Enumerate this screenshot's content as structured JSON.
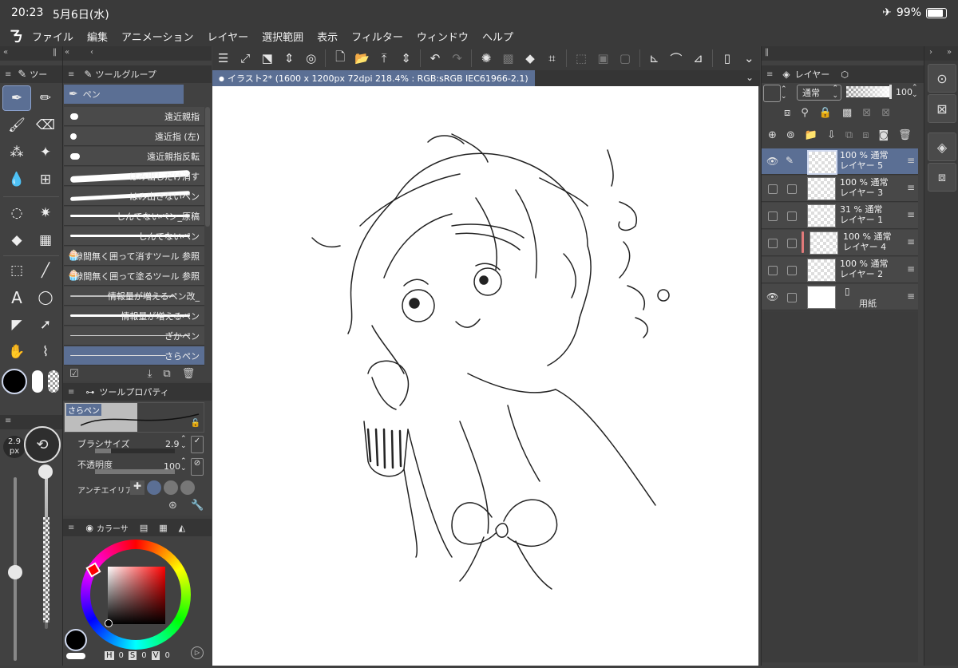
{
  "status": {
    "time": "20:23",
    "date": "5月6日(水)",
    "battery": "99%"
  },
  "menu": [
    "ファイル",
    "編集",
    "アニメーション",
    "レイヤー",
    "選択範囲",
    "表示",
    "フィルター",
    "ウィンドウ",
    "ヘルプ"
  ],
  "panels": {
    "tool_tab": "ツー",
    "subtool_tab": "ツールグループ",
    "subtool_group": "ペン",
    "toolprop_tab": "ツールプロパティ",
    "color_tab": "カラーサ",
    "layer_tab": "レイヤー"
  },
  "brushes": [
    "遠近親指",
    "遠近指 (左)",
    "遠近親指反転",
    "はみ出しだけ消す",
    "はみ出さないペン",
    "しんでないペン_原稿",
    "しんでないペン",
    "隙間無く囲って消すツール 参照",
    "隙間無く囲って塗るツール 参照",
    "情報量が増えるペン改_",
    "情報量が増えるペン",
    "ざかペン",
    "さらペン"
  ],
  "toolprop": {
    "preview_label": "さらペン",
    "brush_size_label": "ブラシサイズ",
    "brush_size_value": "2.9",
    "opacity_label": "不透明度",
    "opacity_value": "100",
    "antialias_label": "アンチエイリアス"
  },
  "brush_size_indicator": {
    "value": "2.9",
    "unit": "px"
  },
  "doc_tab": "イラスト2* (1600 x 1200px 72dpi 218.4% : RGB:sRGB IEC61966-2.1)",
  "layer_controls": {
    "blend_mode": "通常",
    "opacity": "100"
  },
  "layers": [
    {
      "opacity_mode": "100 % 通常",
      "name": "レイヤー 5",
      "visible": true,
      "selected": true
    },
    {
      "opacity_mode": "100 % 通常",
      "name": "レイヤー 3",
      "visible": false,
      "selected": false
    },
    {
      "opacity_mode": "31 % 通常",
      "name": "レイヤー 1",
      "visible": false,
      "selected": false
    },
    {
      "opacity_mode": "100 % 通常",
      "name": "レイヤー 4",
      "visible": false,
      "selected": false
    },
    {
      "opacity_mode": "100 % 通常",
      "name": "レイヤー 2",
      "visible": false,
      "selected": false
    }
  ],
  "paper_layer": {
    "name": "用紙"
  },
  "color_values": {
    "h_label": "H",
    "h": "0",
    "s_label": "S",
    "s": "0",
    "v_label": "V",
    "v": "0"
  },
  "colors": {
    "accent": "#5b6f94",
    "panel": "#414141",
    "main_color": "#000000"
  }
}
